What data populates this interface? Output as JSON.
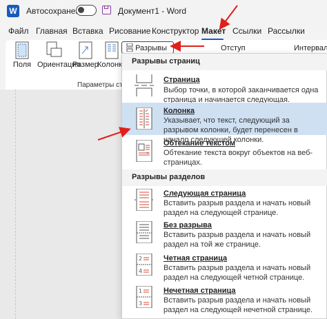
{
  "titlebar": {
    "app_icon_letter": "W",
    "autosave_label": "Автосохранение",
    "doc_title": "Документ1 - Word"
  },
  "tabs": [
    "Файл",
    "Главная",
    "Вставка",
    "Рисование",
    "Конструктор",
    "Макет",
    "Ссылки",
    "Рассылки"
  ],
  "active_tab": "Макет",
  "ribbon": {
    "buttons": [
      "Поля",
      "Ориентация",
      "Размер",
      "Колонки"
    ],
    "group_label": "Параметры стра",
    "breaks_button": "Разрывы",
    "indent_label": "Отступ",
    "spacing_label": "Интервал"
  },
  "menu": {
    "page_breaks_header": "Разрывы страниц",
    "page_breaks": [
      {
        "title": "Страница",
        "desc": "Выбор точки, в которой заканчивается одна страница и начинается следующая."
      },
      {
        "title": "Колонка",
        "desc": "Указывает, что текст, следующий за разрывом колонки, будет перенесен в начало следующей колонки."
      },
      {
        "title": "Обтекание текстом",
        "desc": "Обтекание текста вокруг объектов на веб-страницах."
      }
    ],
    "section_breaks_header": "Разрывы разделов",
    "section_breaks": [
      {
        "title": "Следующая страница",
        "desc": "Вставить разрыв раздела и начать новый раздел на следующей странице."
      },
      {
        "title": "Без разрыва",
        "desc": "Вставить разрыв раздела и начать новый раздел на той же странице."
      },
      {
        "title": "Четная страница",
        "desc": "Вставить разрыв раздела и начать новый раздел на следующей четной странице."
      },
      {
        "title": "Нечетная страница",
        "desc": "Вставить разрыв раздела и начать новый раздел на следующей нечетной странице."
      }
    ]
  },
  "colors": {
    "accent": "#185abd",
    "selected": "#cfe0f3",
    "arrow": "#e0201b",
    "icon_red": "#d9452f"
  }
}
